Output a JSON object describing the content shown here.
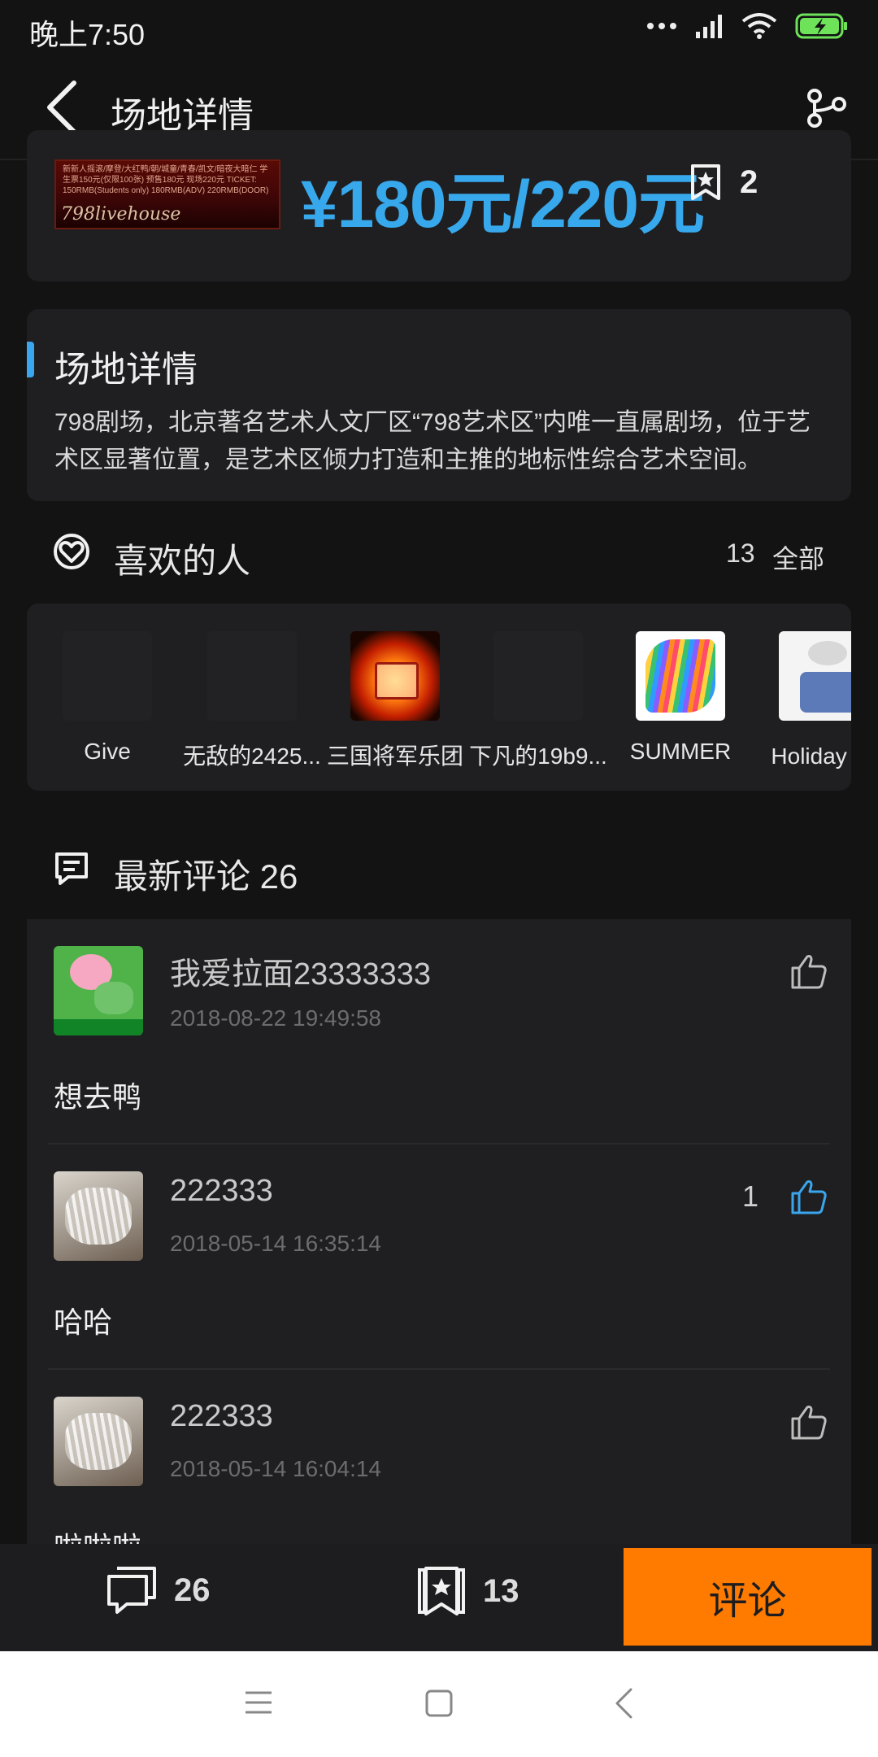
{
  "status": {
    "time": "晚上7:50"
  },
  "header": {
    "title": "场地详情"
  },
  "ticket": {
    "poster_text": "新新人摇滚/摩登/大红鸭/朝/城童/青春/凯文/暗夜大暗仁 学生票150元(仅限100张) 预售180元 现场220元 TICKET: 150RMB(Students only) 180RMB(ADV) 220RMB(DOOR)",
    "poster_brand": "798livehouse",
    "price": "¥180元/220元",
    "favorite_count": "2"
  },
  "details": {
    "title": "场地详情",
    "description": "798剧场，北京著名艺术人文厂区“798艺术区”内唯一直属剧场，位于艺术区显著位置，是艺术区倾力打造和主推的地标性综合艺术空间。"
  },
  "likers": {
    "title": "喜欢的人",
    "count": "13",
    "all_label": "全部",
    "items": [
      {
        "name": "Give"
      },
      {
        "name": "无敌的2425..."
      },
      {
        "name": "三国将军乐团"
      },
      {
        "name": "下凡的19b9..."
      },
      {
        "name": "SUMMER"
      },
      {
        "name": "Holiday 小"
      }
    ]
  },
  "comments": {
    "title": "最新评论 26",
    "items": [
      {
        "user": "我爱拉面23333333",
        "time": "2018-08-22 19:49:58",
        "text": "想去鸭",
        "likes": ""
      },
      {
        "user": "222333",
        "time": "2018-05-14 16:35:14",
        "text": "哈哈",
        "likes": "1"
      },
      {
        "user": "222333",
        "time": "2018-05-14 16:04:14",
        "text": "啦啦啦",
        "likes": ""
      }
    ]
  },
  "actions": {
    "comment_count": "26",
    "collect_count": "13",
    "comment_button": "评论"
  },
  "colors": {
    "accent": "#39a6ee",
    "primary_button": "#ff7b00",
    "background": "#131314",
    "card": "#1f1f21"
  }
}
